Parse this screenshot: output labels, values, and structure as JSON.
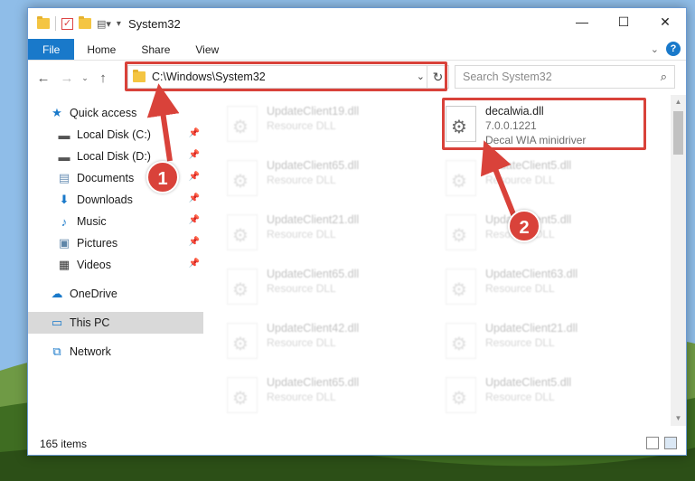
{
  "window": {
    "title": "System32",
    "ribbon_tabs": [
      "File",
      "Home",
      "Share",
      "View"
    ],
    "address": "C:\\Windows\\System32",
    "search_placeholder": "Search System32",
    "status_count": "165 items"
  },
  "sidebar": [
    {
      "label": "Quick access",
      "icon": "star-icon",
      "pinned": false
    },
    {
      "label": "Local Disk (C:)",
      "icon": "drive-icon",
      "pinned": true
    },
    {
      "label": "Local Disk (D:)",
      "icon": "drive-icon",
      "pinned": true
    },
    {
      "label": "Documents",
      "icon": "documents-icon",
      "pinned": true
    },
    {
      "label": "Downloads",
      "icon": "downloads-icon",
      "pinned": true
    },
    {
      "label": "Music",
      "icon": "music-icon",
      "pinned": true
    },
    {
      "label": "Pictures",
      "icon": "pictures-icon",
      "pinned": true
    },
    {
      "label": "Videos",
      "icon": "videos-icon",
      "pinned": true
    },
    {
      "label": "OneDrive",
      "icon": "onedrive-icon",
      "pinned": false
    },
    {
      "label": "This PC",
      "icon": "pc-icon",
      "pinned": false,
      "selected": true
    },
    {
      "label": "Network",
      "icon": "network-icon",
      "pinned": false
    }
  ],
  "files": [
    {
      "name": "UpdateClient19.dll",
      "sub": "Resource DLL"
    },
    {
      "name": "decalwia.dll",
      "sub": "7.0.0.1221",
      "sub2": "Decal WIA minidriver",
      "highlighted": true
    },
    {
      "name": "UpdateClient65.dll",
      "sub": "Resource DLL"
    },
    {
      "name": "UpdateClient5.dll",
      "sub": "Resource DLL"
    },
    {
      "name": "UpdateClient21.dll",
      "sub": "Resource DLL"
    },
    {
      "name": "UpdateClient5.dll",
      "sub": "Resource DLL"
    },
    {
      "name": "UpdateClient65.dll",
      "sub": "Resource DLL"
    },
    {
      "name": "UpdateClient63.dll",
      "sub": "Resource DLL"
    },
    {
      "name": "UpdateClient42.dll",
      "sub": "Resource DLL"
    },
    {
      "name": "UpdateClient21.dll",
      "sub": "Resource DLL"
    },
    {
      "name": "UpdateClient65.dll",
      "sub": "Resource DLL"
    },
    {
      "name": "UpdateClient5.dll",
      "sub": "Resource DLL"
    }
  ],
  "callouts": [
    "1",
    "2"
  ],
  "colors": {
    "accent": "#1979ca",
    "highlight": "#d9423a"
  }
}
